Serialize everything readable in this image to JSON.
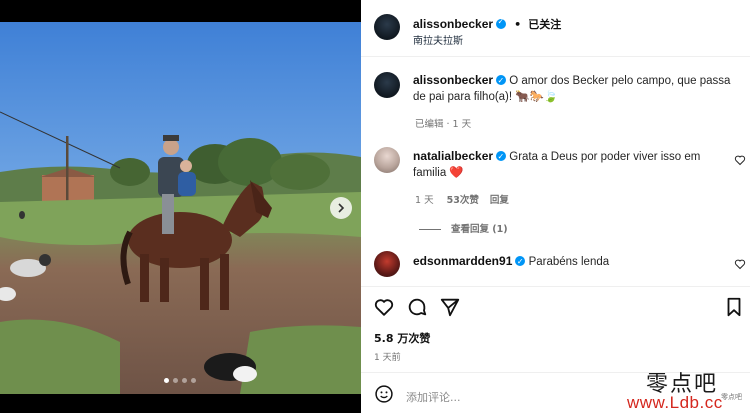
{
  "post": {
    "author": "alissonbecker",
    "separator": "•",
    "follow_label": "已关注",
    "location": "南拉夫拉斯",
    "caption_user": "alissonbecker",
    "caption_text": "O amor dos Becker pelo campo, que passa de pai para filho(a)! 🐂🐎🍃",
    "caption_meta": "已编辑 · 1 天"
  },
  "comments": [
    {
      "user": "natalialbecker",
      "text": "Grata a Deus por poder viver isso em familia ❤️",
      "time": "1 天",
      "likes": "53次赞",
      "reply": "回复",
      "view_replies": "查看回复 (1)"
    },
    {
      "user": "edsonmardden91",
      "text": "Parabéns lenda"
    }
  ],
  "footer": {
    "likes": "5.8 万次赞",
    "time": "1 天前",
    "comment_placeholder": "添加评论..."
  },
  "icons": {
    "like": "heart-icon",
    "comment": "comment-icon",
    "share": "share-icon",
    "save": "bookmark-icon",
    "emoji": "emoji-icon",
    "next": "chevron-right-icon"
  },
  "carousel": {
    "slides": 4,
    "active": 1
  },
  "watermark": {
    "cn": "零点吧",
    "url": "www.Ldb.cc",
    "small": "零点吧"
  },
  "colors": {
    "verified": "#0095f6",
    "watermark_red": "#d4271e"
  }
}
